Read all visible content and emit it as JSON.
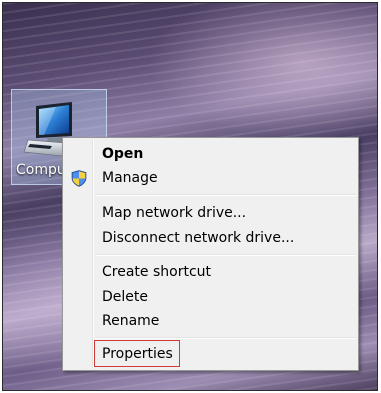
{
  "desktop": {
    "icon_label": "Computer"
  },
  "context_menu": {
    "items": [
      {
        "label": "Open",
        "bold": true
      },
      {
        "label": "Manage",
        "icon": "uac-shield-icon"
      },
      {
        "label": "Map network drive..."
      },
      {
        "label": "Disconnect network drive..."
      },
      {
        "label": "Create shortcut"
      },
      {
        "label": "Delete"
      },
      {
        "label": "Rename"
      },
      {
        "label": "Properties",
        "highlighted": true
      }
    ]
  },
  "colors": {
    "highlight_border": "#d23a3a",
    "menu_background": "#f0f0f0"
  }
}
